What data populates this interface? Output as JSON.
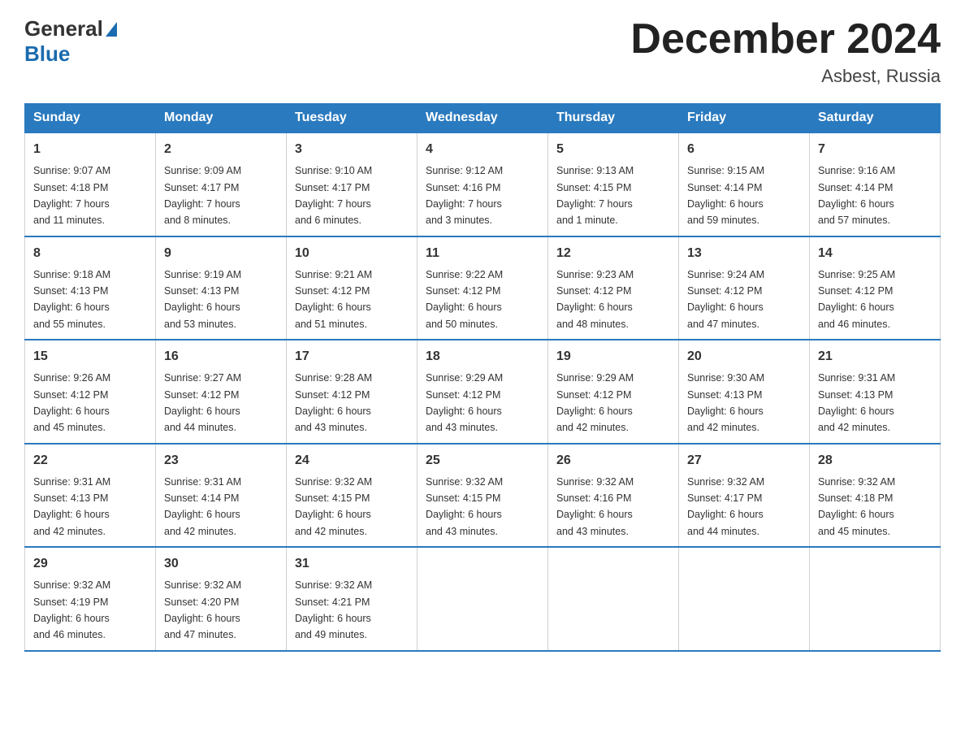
{
  "header": {
    "logo_general": "General",
    "logo_blue": "Blue",
    "month_title": "December 2024",
    "location": "Asbest, Russia"
  },
  "calendar": {
    "days_of_week": [
      "Sunday",
      "Monday",
      "Tuesday",
      "Wednesday",
      "Thursday",
      "Friday",
      "Saturday"
    ],
    "weeks": [
      [
        {
          "day": "1",
          "sunrise": "Sunrise: 9:07 AM",
          "sunset": "Sunset: 4:18 PM",
          "daylight": "Daylight: 7 hours",
          "minutes": "and 11 minutes."
        },
        {
          "day": "2",
          "sunrise": "Sunrise: 9:09 AM",
          "sunset": "Sunset: 4:17 PM",
          "daylight": "Daylight: 7 hours",
          "minutes": "and 8 minutes."
        },
        {
          "day": "3",
          "sunrise": "Sunrise: 9:10 AM",
          "sunset": "Sunset: 4:17 PM",
          "daylight": "Daylight: 7 hours",
          "minutes": "and 6 minutes."
        },
        {
          "day": "4",
          "sunrise": "Sunrise: 9:12 AM",
          "sunset": "Sunset: 4:16 PM",
          "daylight": "Daylight: 7 hours",
          "minutes": "and 3 minutes."
        },
        {
          "day": "5",
          "sunrise": "Sunrise: 9:13 AM",
          "sunset": "Sunset: 4:15 PM",
          "daylight": "Daylight: 7 hours",
          "minutes": "and 1 minute."
        },
        {
          "day": "6",
          "sunrise": "Sunrise: 9:15 AM",
          "sunset": "Sunset: 4:14 PM",
          "daylight": "Daylight: 6 hours",
          "minutes": "and 59 minutes."
        },
        {
          "day": "7",
          "sunrise": "Sunrise: 9:16 AM",
          "sunset": "Sunset: 4:14 PM",
          "daylight": "Daylight: 6 hours",
          "minutes": "and 57 minutes."
        }
      ],
      [
        {
          "day": "8",
          "sunrise": "Sunrise: 9:18 AM",
          "sunset": "Sunset: 4:13 PM",
          "daylight": "Daylight: 6 hours",
          "minutes": "and 55 minutes."
        },
        {
          "day": "9",
          "sunrise": "Sunrise: 9:19 AM",
          "sunset": "Sunset: 4:13 PM",
          "daylight": "Daylight: 6 hours",
          "minutes": "and 53 minutes."
        },
        {
          "day": "10",
          "sunrise": "Sunrise: 9:21 AM",
          "sunset": "Sunset: 4:12 PM",
          "daylight": "Daylight: 6 hours",
          "minutes": "and 51 minutes."
        },
        {
          "day": "11",
          "sunrise": "Sunrise: 9:22 AM",
          "sunset": "Sunset: 4:12 PM",
          "daylight": "Daylight: 6 hours",
          "minutes": "and 50 minutes."
        },
        {
          "day": "12",
          "sunrise": "Sunrise: 9:23 AM",
          "sunset": "Sunset: 4:12 PM",
          "daylight": "Daylight: 6 hours",
          "minutes": "and 48 minutes."
        },
        {
          "day": "13",
          "sunrise": "Sunrise: 9:24 AM",
          "sunset": "Sunset: 4:12 PM",
          "daylight": "Daylight: 6 hours",
          "minutes": "and 47 minutes."
        },
        {
          "day": "14",
          "sunrise": "Sunrise: 9:25 AM",
          "sunset": "Sunset: 4:12 PM",
          "daylight": "Daylight: 6 hours",
          "minutes": "and 46 minutes."
        }
      ],
      [
        {
          "day": "15",
          "sunrise": "Sunrise: 9:26 AM",
          "sunset": "Sunset: 4:12 PM",
          "daylight": "Daylight: 6 hours",
          "minutes": "and 45 minutes."
        },
        {
          "day": "16",
          "sunrise": "Sunrise: 9:27 AM",
          "sunset": "Sunset: 4:12 PM",
          "daylight": "Daylight: 6 hours",
          "minutes": "and 44 minutes."
        },
        {
          "day": "17",
          "sunrise": "Sunrise: 9:28 AM",
          "sunset": "Sunset: 4:12 PM",
          "daylight": "Daylight: 6 hours",
          "minutes": "and 43 minutes."
        },
        {
          "day": "18",
          "sunrise": "Sunrise: 9:29 AM",
          "sunset": "Sunset: 4:12 PM",
          "daylight": "Daylight: 6 hours",
          "minutes": "and 43 minutes."
        },
        {
          "day": "19",
          "sunrise": "Sunrise: 9:29 AM",
          "sunset": "Sunset: 4:12 PM",
          "daylight": "Daylight: 6 hours",
          "minutes": "and 42 minutes."
        },
        {
          "day": "20",
          "sunrise": "Sunrise: 9:30 AM",
          "sunset": "Sunset: 4:13 PM",
          "daylight": "Daylight: 6 hours",
          "minutes": "and 42 minutes."
        },
        {
          "day": "21",
          "sunrise": "Sunrise: 9:31 AM",
          "sunset": "Sunset: 4:13 PM",
          "daylight": "Daylight: 6 hours",
          "minutes": "and 42 minutes."
        }
      ],
      [
        {
          "day": "22",
          "sunrise": "Sunrise: 9:31 AM",
          "sunset": "Sunset: 4:13 PM",
          "daylight": "Daylight: 6 hours",
          "minutes": "and 42 minutes."
        },
        {
          "day": "23",
          "sunrise": "Sunrise: 9:31 AM",
          "sunset": "Sunset: 4:14 PM",
          "daylight": "Daylight: 6 hours",
          "minutes": "and 42 minutes."
        },
        {
          "day": "24",
          "sunrise": "Sunrise: 9:32 AM",
          "sunset": "Sunset: 4:15 PM",
          "daylight": "Daylight: 6 hours",
          "minutes": "and 42 minutes."
        },
        {
          "day": "25",
          "sunrise": "Sunrise: 9:32 AM",
          "sunset": "Sunset: 4:15 PM",
          "daylight": "Daylight: 6 hours",
          "minutes": "and 43 minutes."
        },
        {
          "day": "26",
          "sunrise": "Sunrise: 9:32 AM",
          "sunset": "Sunset: 4:16 PM",
          "daylight": "Daylight: 6 hours",
          "minutes": "and 43 minutes."
        },
        {
          "day": "27",
          "sunrise": "Sunrise: 9:32 AM",
          "sunset": "Sunset: 4:17 PM",
          "daylight": "Daylight: 6 hours",
          "minutes": "and 44 minutes."
        },
        {
          "day": "28",
          "sunrise": "Sunrise: 9:32 AM",
          "sunset": "Sunset: 4:18 PM",
          "daylight": "Daylight: 6 hours",
          "minutes": "and 45 minutes."
        }
      ],
      [
        {
          "day": "29",
          "sunrise": "Sunrise: 9:32 AM",
          "sunset": "Sunset: 4:19 PM",
          "daylight": "Daylight: 6 hours",
          "minutes": "and 46 minutes."
        },
        {
          "day": "30",
          "sunrise": "Sunrise: 9:32 AM",
          "sunset": "Sunset: 4:20 PM",
          "daylight": "Daylight: 6 hours",
          "minutes": "and 47 minutes."
        },
        {
          "day": "31",
          "sunrise": "Sunrise: 9:32 AM",
          "sunset": "Sunset: 4:21 PM",
          "daylight": "Daylight: 6 hours",
          "minutes": "and 49 minutes."
        },
        null,
        null,
        null,
        null
      ]
    ]
  }
}
